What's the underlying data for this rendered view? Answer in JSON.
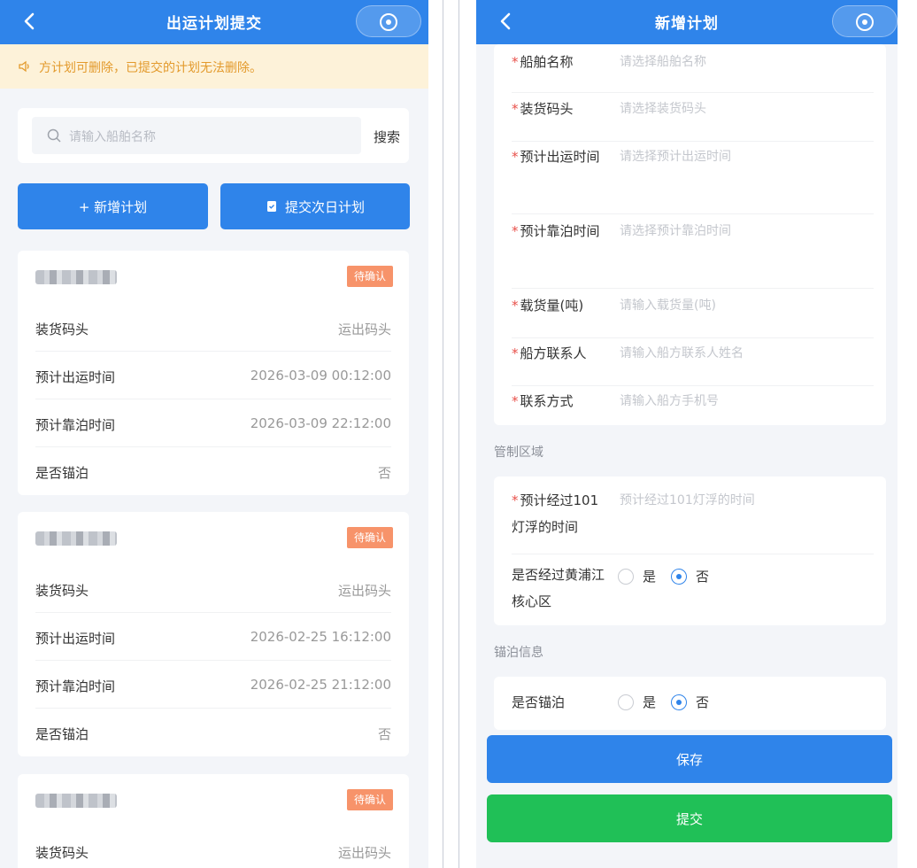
{
  "left": {
    "title": "出运计划提交",
    "notice": "方计划可删除，已提交的计划无法删除。",
    "search": {
      "placeholder": "请输入船舶名称",
      "button": "搜索"
    },
    "buttons": {
      "add": "+ 新增计划",
      "submit": "提交次日计划"
    },
    "cards": [
      {
        "status": "待确认",
        "rows": [
          {
            "k": "装货码头",
            "v": "运出码头"
          },
          {
            "k": "预计出运时间",
            "v": "2026-03-09 00:12:00"
          },
          {
            "k": "预计靠泊时间",
            "v": "2026-03-09 22:12:00"
          },
          {
            "k": "是否锚泊",
            "v": "否"
          }
        ]
      },
      {
        "status": "待确认",
        "rows": [
          {
            "k": "装货码头",
            "v": "运出码头"
          },
          {
            "k": "预计出运时间",
            "v": "2026-02-25 16:12:00"
          },
          {
            "k": "预计靠泊时间",
            "v": "2026-02-25 21:12:00"
          },
          {
            "k": "是否锚泊",
            "v": "否"
          }
        ]
      },
      {
        "status": "待确认",
        "rows": [
          {
            "k": "装货码头",
            "v": "运出码头"
          }
        ]
      }
    ]
  },
  "right": {
    "title": "新增计划",
    "fields": [
      {
        "label": "船舶名称",
        "placeholder": "请选择船舶名称"
      },
      {
        "label": "装货码头",
        "placeholder": "请选择装货码头"
      },
      {
        "label": "预计出运时间",
        "placeholder": "请选择预计出运时间"
      },
      {
        "label": "预计靠泊时间",
        "placeholder": "请选择预计靠泊时间"
      },
      {
        "label": "载货量(吨)",
        "placeholder": "请输入载货量(吨)"
      },
      {
        "label": "船方联系人",
        "placeholder": "请输入船方联系人姓名"
      },
      {
        "label": "联系方式",
        "placeholder": "请输入船方手机号"
      }
    ],
    "section_control": "管制区域",
    "lamp_field": {
      "label": "预计经过101灯浮的时间",
      "placeholder": "预计经过101灯浮的时间"
    },
    "huangpu": {
      "label": "是否经过黄浦江核心区",
      "yes": "是",
      "no": "否"
    },
    "section_anchor": "锚泊信息",
    "anchor": {
      "label": "是否锚泊",
      "yes": "是",
      "no": "否"
    },
    "save": "保存",
    "submit": "提交"
  },
  "colors": {
    "primary": "#2f84ea",
    "success": "#20c057",
    "badge": "#f7936a",
    "required": "#e8504a"
  },
  "icons": [
    "back-icon",
    "capsule-icon",
    "speaker-icon",
    "search-icon",
    "plus-icon",
    "clipboard-icon"
  ]
}
